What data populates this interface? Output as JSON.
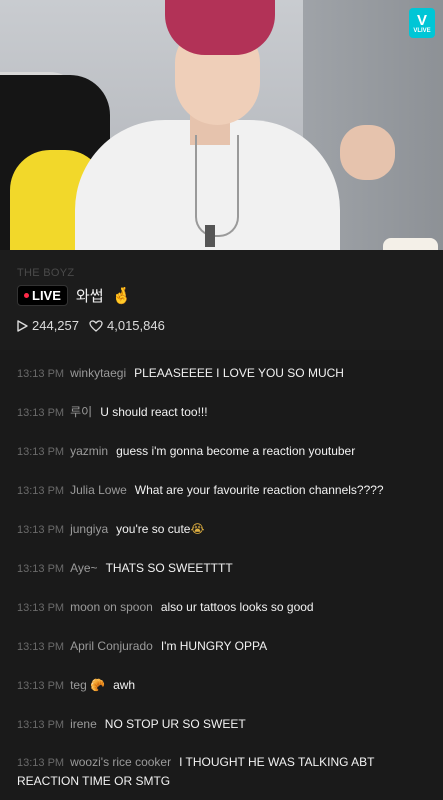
{
  "watermark": {
    "top": "V",
    "bottom": "VLIVE"
  },
  "channel": "THE BOYZ",
  "live_label": "LIVE",
  "title": "와썹",
  "title_emoji": "🤞",
  "stats": {
    "views": "244,257",
    "likes": "4,015,846"
  },
  "colors": {
    "accent": "#00c6d6",
    "live_dot": "#ff2a49",
    "background": "#1a1a1a"
  },
  "chat": [
    {
      "time": "13:13 PM",
      "user": "winkytaegi",
      "text": "PLEAASEEEE I LOVE YOU SO MUCH",
      "emoji": ""
    },
    {
      "time": "13:13 PM",
      "user": "루이",
      "text": "U should react too!!!",
      "emoji": ""
    },
    {
      "time": "13:13 PM",
      "user": "yazmin",
      "text": "guess i'm gonna become a reaction youtuber",
      "emoji": ""
    },
    {
      "time": "13:13 PM",
      "user": "Julia Lowe",
      "text": "What are your favourite reaction channels????",
      "emoji": ""
    },
    {
      "time": "13:13 PM",
      "user": "jungiya",
      "text": "you're so cute",
      "emoji": "😭"
    },
    {
      "time": "13:13 PM",
      "user": "Aye~",
      "text": "THATS SO SWEETTTT",
      "emoji": ""
    },
    {
      "time": "13:13 PM",
      "user": "moon on spoon",
      "text": "also ur tattoos looks so good",
      "emoji": ""
    },
    {
      "time": "13:13 PM",
      "user": "April Conjurado",
      "text": "I'm HUNGRY OPPA",
      "emoji": ""
    },
    {
      "time": "13:13 PM",
      "user": "teg 🥐",
      "text": "awh",
      "emoji": ""
    },
    {
      "time": "13:13 PM",
      "user": "irene",
      "text": "NO STOP UR SO SWEET",
      "emoji": ""
    },
    {
      "time": "13:13 PM",
      "user": "woozi's rice cooker",
      "text": "I THOUGHT HE WAS TALKING ABT REACTION TIME OR SMTG",
      "emoji": ""
    }
  ]
}
